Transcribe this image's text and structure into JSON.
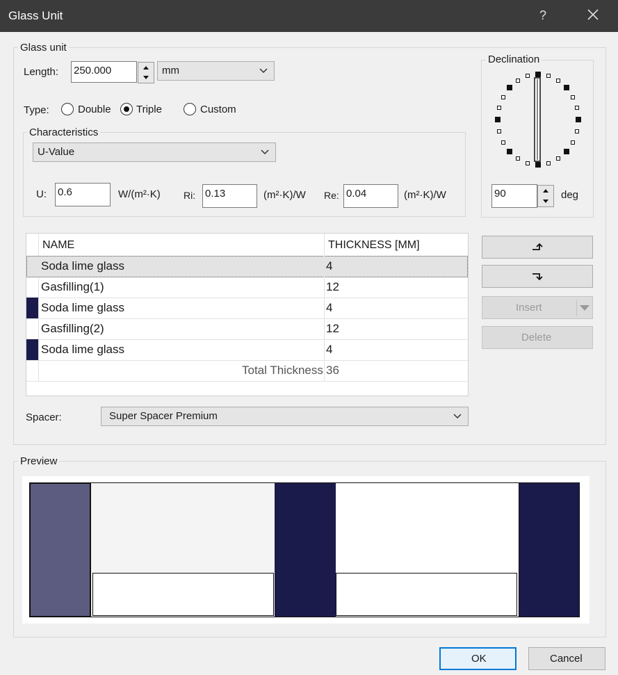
{
  "window": {
    "title": "Glass Unit",
    "help": "?"
  },
  "glass_unit": {
    "group_label": "Glass unit",
    "length_label": "Length:",
    "length_value": "250.000",
    "unit": "mm",
    "type_label": "Type:",
    "type_options": [
      "Double",
      "Triple",
      "Custom"
    ],
    "type_selected": "Triple"
  },
  "characteristics": {
    "group_label": "Characteristics",
    "selected": "U-Value",
    "u_label": "U:",
    "u_value": "0.6",
    "u_unit": "W/(m²·K)",
    "ri_label": "Ri:",
    "ri_value": "0.13",
    "ri_unit": "(m²·K)/W",
    "re_label": "Re:",
    "re_value": "0.04",
    "re_unit": "(m²·K)/W"
  },
  "declination": {
    "label": "Declination",
    "value": "90",
    "unit": "deg"
  },
  "layers": {
    "columns": [
      "NAME",
      "THICKNESS [MM]"
    ],
    "rows": [
      {
        "name": "Soda lime glass",
        "thickness": "4"
      },
      {
        "name": "Gasfilling(1)",
        "thickness": "12"
      },
      {
        "name": "Soda lime glass",
        "thickness": "4"
      },
      {
        "name": "Gasfilling(2)",
        "thickness": "12"
      },
      {
        "name": "Soda lime glass",
        "thickness": "4"
      }
    ],
    "total_label": "Total Thickness",
    "total_value": "36"
  },
  "side_buttons": {
    "move_up": "↑",
    "move_down": "↓",
    "insert": "Insert",
    "delete": "Delete"
  },
  "spacer": {
    "label": "Spacer:",
    "selected": "Super Spacer Premium"
  },
  "preview": {
    "label": "Preview"
  },
  "footer": {
    "ok": "OK",
    "cancel": "Cancel"
  },
  "colors": {
    "glass": "#1b1b4b",
    "glass_selected": "#5c5c80",
    "titlebar": "#3b3b3b"
  }
}
